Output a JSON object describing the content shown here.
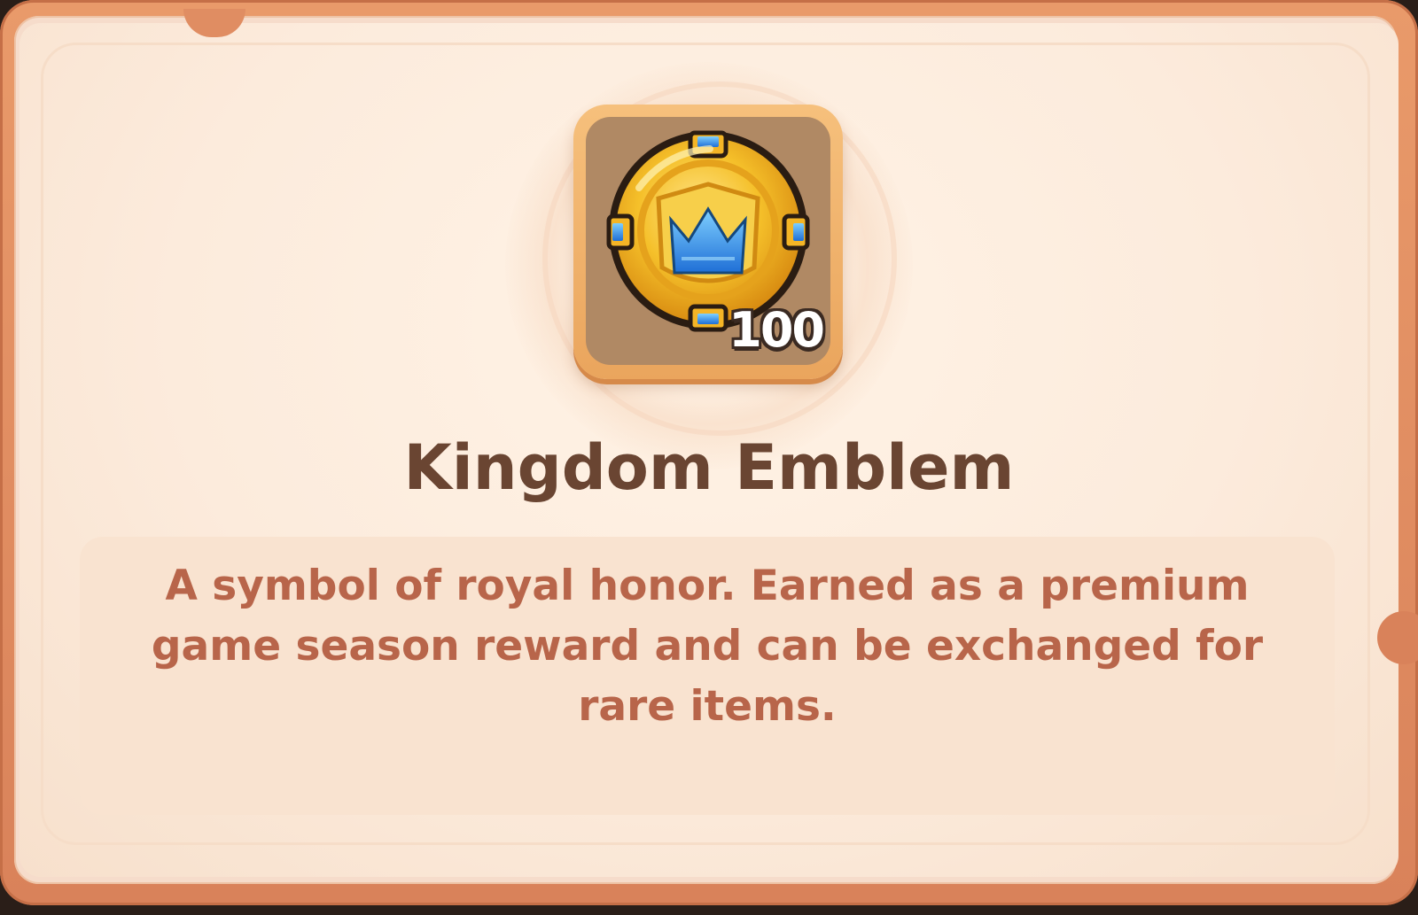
{
  "item": {
    "name": "Kingdom Emblem",
    "count": "100",
    "description": "A symbol of royal honor. Earned as a premium game season reward and can be exchanged for rare items.",
    "icon": "kingdom-emblem-icon"
  },
  "colors": {
    "frame": "#d9825a",
    "panel": "#fcebdc",
    "title": "#6a4532",
    "description": "#b8654a",
    "slot": "#b08964",
    "emblem_gold": "#f5c02a",
    "emblem_gem": "#2f8fe6"
  }
}
